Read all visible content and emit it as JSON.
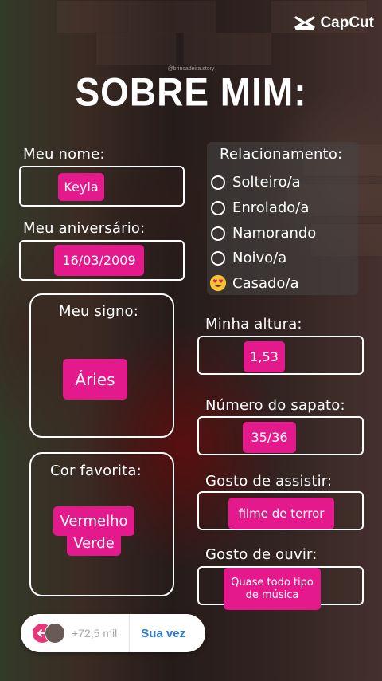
{
  "brand": {
    "name": "CapCut",
    "icon": "capcut-logo-icon"
  },
  "watermark": "@brincadeira.story",
  "title": "SOBRE MIM:",
  "colors": {
    "accent": "#e41a8c",
    "link": "#2e7bd6",
    "text": "#ffffff"
  },
  "fields": {
    "nome": {
      "label": "Meu nome:",
      "value": "Keyla"
    },
    "aniversario": {
      "label": "Meu aniversário:",
      "value": "16/03/2009"
    },
    "signo": {
      "label": "Meu signo:",
      "value": "Áries"
    },
    "cor": {
      "label": "Cor favorita:",
      "value_line1": "Vermelho",
      "value_line2": "Verde"
    },
    "altura": {
      "label": "Minha altura:",
      "value": "1,53"
    },
    "sapato": {
      "label": "Número do sapato:",
      "value": "35/36"
    },
    "assistir": {
      "label": "Gosto de assistir:",
      "value": "filme de terror"
    },
    "ouvir": {
      "label": "Gosto de ouvir:",
      "value_line1": "Quase todo tipo",
      "value_line2": "de música"
    }
  },
  "relacionamento": {
    "label": "Relacionamento:",
    "options": [
      {
        "label": "Solteiro/a",
        "selected": false
      },
      {
        "label": "Enrolado/a",
        "selected": false
      },
      {
        "label": "Namorando",
        "selected": false
      },
      {
        "label": "Noivo/a",
        "selected": false
      },
      {
        "label": "Casado/a",
        "selected": true,
        "icon": "heart-eyes-emoji-icon"
      }
    ]
  },
  "footer": {
    "count": "+72,5 mil",
    "cta": "Sua vez"
  }
}
